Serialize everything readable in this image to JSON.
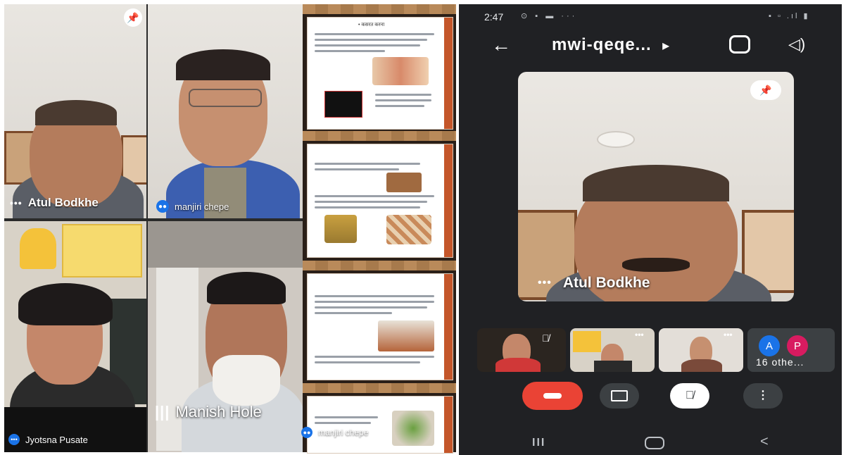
{
  "grid": {
    "tiles": [
      {
        "name": "Atul Bodkhe"
      },
      {
        "name": "manjiri chepe"
      },
      {
        "name": "Jyotsna Pusate"
      },
      {
        "name": "Manish Hole"
      }
    ],
    "slide_strip_name": "manjiri chepe",
    "slide_title": "• कसरत करना"
  },
  "phone": {
    "status_time": "2:47",
    "meeting_code": "mwi-qeqe...",
    "main_speaker": "Atul Bodkhe",
    "others_label": "16 othe...",
    "avatars": [
      {
        "letter": "A",
        "color": "#1a73e8"
      },
      {
        "letter": "P",
        "color": "#d81b60"
      }
    ],
    "nav": {
      "recent": "III",
      "home": "○",
      "back": "<"
    }
  },
  "colors": {
    "hangup": "#ea4335",
    "dark_bg": "#202124",
    "slide_accent": "#c4562a",
    "button_dark": "#3c4043"
  }
}
